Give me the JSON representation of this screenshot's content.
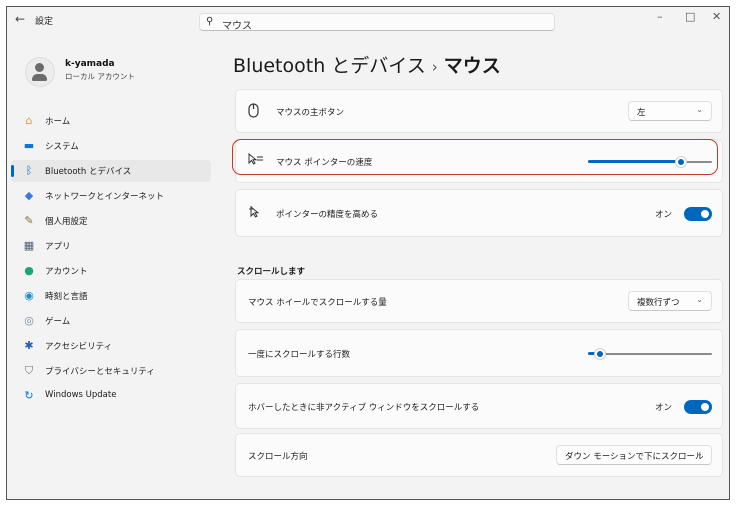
{
  "window": {
    "back_icon": "←",
    "title": "設定",
    "minimize": "–",
    "maximize": "□",
    "close": "✕"
  },
  "search": {
    "icon": "⚲",
    "value": "マウス"
  },
  "user": {
    "name": "k-yamada",
    "type": "ローカル アカウント"
  },
  "sidebar": {
    "items": [
      {
        "label": "ホーム",
        "icon": "home-icon",
        "glyph": "⌂",
        "color": "#e4a11b",
        "selected": false
      },
      {
        "label": "システム",
        "icon": "monitor-icon",
        "glyph": "▬",
        "color": "#0a74da",
        "selected": false
      },
      {
        "label": "Bluetooth とデバイス",
        "icon": "bluetooth-icon",
        "glyph": "ᛒ",
        "color": "#0a74da",
        "selected": true
      },
      {
        "label": "ネットワークとインターネット",
        "icon": "wifi-icon",
        "glyph": "◆",
        "color": "#3b7bd6",
        "selected": false
      },
      {
        "label": "個人用設定",
        "icon": "brush-icon",
        "glyph": "✎",
        "color": "#8a6d3b",
        "selected": false
      },
      {
        "label": "アプリ",
        "icon": "apps-icon",
        "glyph": "▦",
        "color": "#4d5d75",
        "selected": false
      },
      {
        "label": "アカウント",
        "icon": "account-icon",
        "glyph": "●",
        "color": "#1fa37a",
        "selected": false
      },
      {
        "label": "時刻と言語",
        "icon": "globe-icon",
        "glyph": "◉",
        "color": "#1b8fbd",
        "selected": false
      },
      {
        "label": "ゲーム",
        "icon": "gamepad-icon",
        "glyph": "◎",
        "color": "#7a8594",
        "selected": false
      },
      {
        "label": "アクセシビリティ",
        "icon": "accessibility-icon",
        "glyph": "✱",
        "color": "#1f5fb5",
        "selected": false
      },
      {
        "label": "プライバシーとセキュリティ",
        "icon": "shield-icon",
        "glyph": "⛉",
        "color": "#6b7480",
        "selected": false
      },
      {
        "label": "Windows Update",
        "icon": "update-icon",
        "glyph": "↻",
        "color": "#0a74da",
        "selected": false
      }
    ]
  },
  "breadcrumb": {
    "parent": "Bluetooth とデバイス",
    "separator": "›",
    "current": "マウス"
  },
  "settings": {
    "primary_button": {
      "label": "マウスの主ボタン",
      "icon": "mouse-icon",
      "value": "左"
    },
    "pointer_speed": {
      "label": "マウス ポインターの速度",
      "icon": "pointer-speed-icon",
      "level": 0.75
    },
    "pointer_precision": {
      "label": "ポインターの精度を高める",
      "icon": "pointer-precision-icon",
      "state": "オン"
    }
  },
  "scroll_section": {
    "title": "スクロールします",
    "wheel_amount": {
      "label": "マウス ホイールでスクロールする量",
      "value": "複数行ずつ"
    },
    "lines_per_scroll": {
      "label": "一度にスクロールする行数",
      "level": 0.1
    },
    "hover_scroll": {
      "label": "ホバーしたときに非アクティブ ウィンドウをスクロールする",
      "state": "オン"
    },
    "scroll_direction": {
      "label": "スクロール方向",
      "value": "ダウン モーションで下にスクロール"
    }
  },
  "colors": {
    "accent": "#0067c0",
    "highlight_border": "#c0392b"
  }
}
